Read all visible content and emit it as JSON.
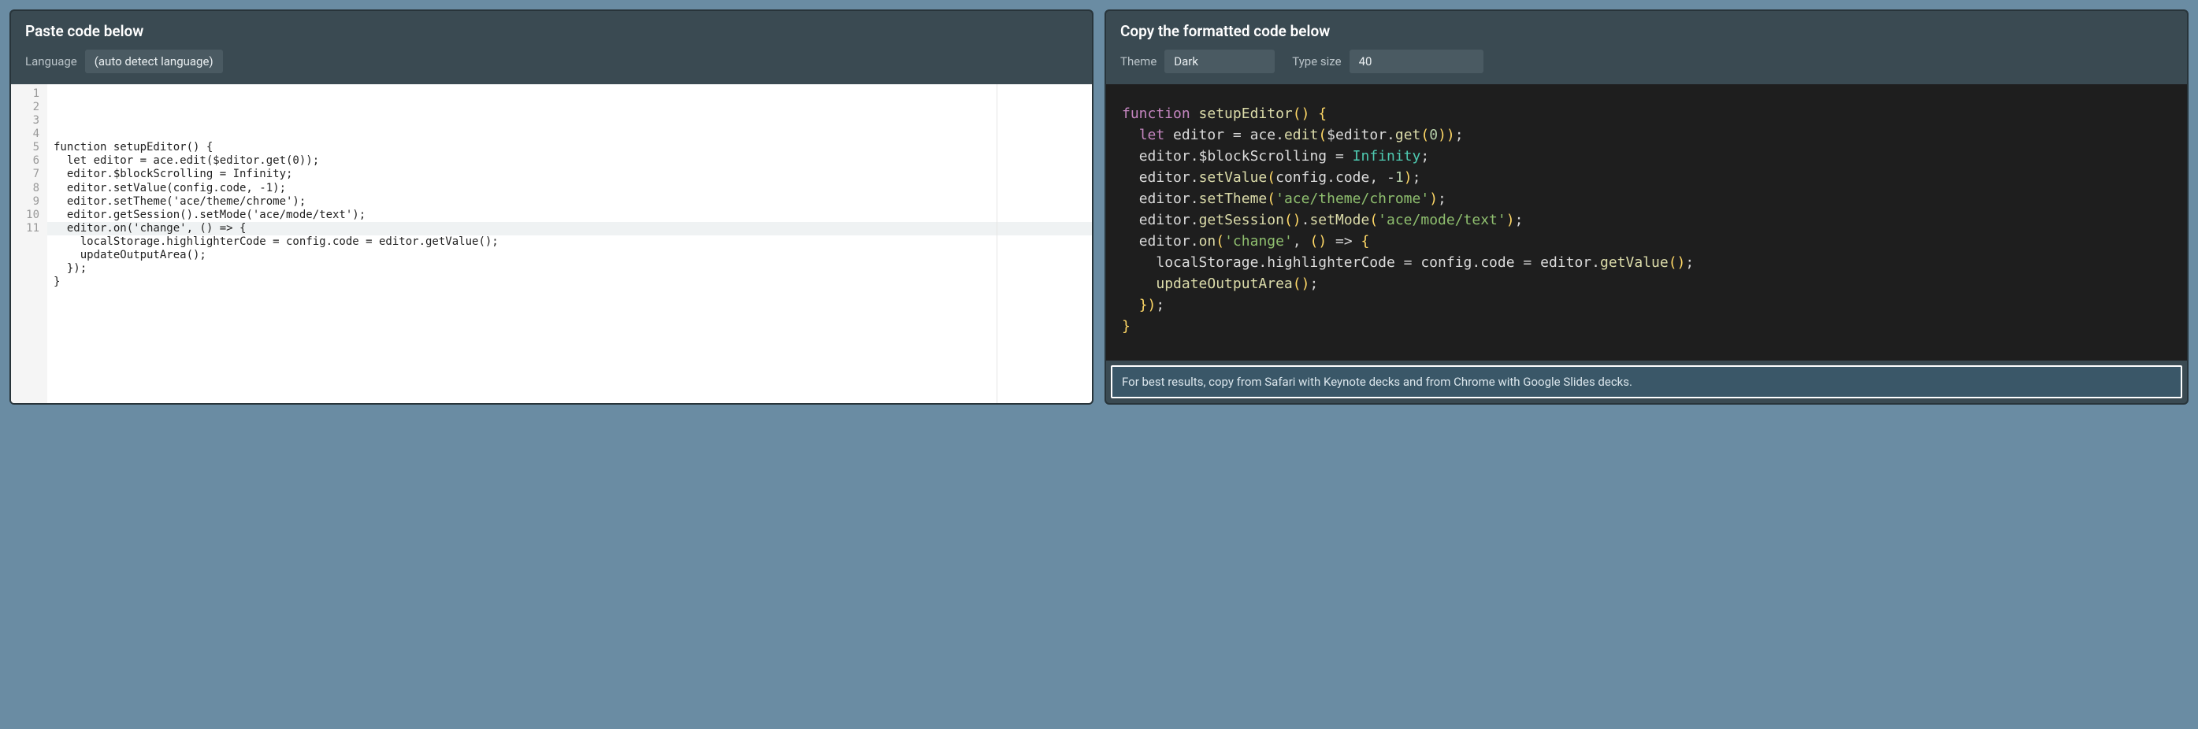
{
  "left": {
    "title": "Paste code below",
    "language_label": "Language",
    "language_value": "(auto detect language)",
    "line_numbers": [
      "1",
      "2",
      "3",
      "4",
      "5",
      "6",
      "7",
      "8",
      "9",
      "10",
      "11"
    ],
    "code_lines": [
      "function setupEditor() {",
      "  let editor = ace.edit($editor.get(0));",
      "  editor.$blockScrolling = Infinity;",
      "  editor.setValue(config.code, -1);",
      "  editor.setTheme('ace/theme/chrome');",
      "  editor.getSession().setMode('ace/mode/text');",
      "  editor.on('change', () => {",
      "    localStorage.highlighterCode = config.code = editor.getValue();",
      "    updateOutputArea();",
      "  });",
      "}"
    ],
    "active_line_index": 10
  },
  "right": {
    "title": "Copy the formatted code below",
    "theme_label": "Theme",
    "theme_value": "Dark",
    "size_label": "Type size",
    "size_value": "40",
    "tokens": [
      [
        [
          "k",
          "function"
        ],
        [
          "w",
          " "
        ],
        [
          "fn",
          "setupEditor"
        ],
        [
          "p",
          "()"
        ],
        [
          "w",
          " "
        ],
        [
          "p",
          "{"
        ]
      ],
      [
        [
          "w",
          "  "
        ],
        [
          "k",
          "let"
        ],
        [
          "w",
          " "
        ],
        [
          "w",
          "editor"
        ],
        [
          "w",
          " "
        ],
        [
          "op",
          "="
        ],
        [
          "w",
          " "
        ],
        [
          "w",
          "ace"
        ],
        [
          "op",
          "."
        ],
        [
          "fn",
          "edit"
        ],
        [
          "p",
          "("
        ],
        [
          "w",
          "$editor"
        ],
        [
          "op",
          "."
        ],
        [
          "fn",
          "get"
        ],
        [
          "p",
          "("
        ],
        [
          "num",
          "0"
        ],
        [
          "p",
          "))"
        ],
        [
          "op",
          ";"
        ]
      ],
      [
        [
          "w",
          "  "
        ],
        [
          "w",
          "editor"
        ],
        [
          "op",
          "."
        ],
        [
          "w",
          "$blockScrolling"
        ],
        [
          "w",
          " "
        ],
        [
          "op",
          "="
        ],
        [
          "w",
          " "
        ],
        [
          "c-id",
          "Infinity"
        ],
        [
          "op",
          ";"
        ]
      ],
      [
        [
          "w",
          "  "
        ],
        [
          "w",
          "editor"
        ],
        [
          "op",
          "."
        ],
        [
          "fn",
          "setValue"
        ],
        [
          "p",
          "("
        ],
        [
          "w",
          "config"
        ],
        [
          "op",
          "."
        ],
        [
          "w",
          "code"
        ],
        [
          "op",
          ","
        ],
        [
          "w",
          " "
        ],
        [
          "op",
          "-"
        ],
        [
          "num",
          "1"
        ],
        [
          "p",
          ")"
        ],
        [
          "op",
          ";"
        ]
      ],
      [
        [
          "w",
          "  "
        ],
        [
          "w",
          "editor"
        ],
        [
          "op",
          "."
        ],
        [
          "fn",
          "setTheme"
        ],
        [
          "p",
          "("
        ],
        [
          "str2",
          "'ace/theme/chrome'"
        ],
        [
          "p",
          ")"
        ],
        [
          "op",
          ";"
        ]
      ],
      [
        [
          "w",
          "  "
        ],
        [
          "w",
          "editor"
        ],
        [
          "op",
          "."
        ],
        [
          "fn",
          "getSession"
        ],
        [
          "p",
          "()"
        ],
        [
          "op",
          "."
        ],
        [
          "fn",
          "setMode"
        ],
        [
          "p",
          "("
        ],
        [
          "str2",
          "'ace/mode/text'"
        ],
        [
          "p",
          ")"
        ],
        [
          "op",
          ";"
        ]
      ],
      [
        [
          "w",
          "  "
        ],
        [
          "w",
          "editor"
        ],
        [
          "op",
          "."
        ],
        [
          "fn",
          "on"
        ],
        [
          "p",
          "("
        ],
        [
          "str2",
          "'change'"
        ],
        [
          "op",
          ","
        ],
        [
          "w",
          " "
        ],
        [
          "p",
          "()"
        ],
        [
          "w",
          " "
        ],
        [
          "op",
          "=>"
        ],
        [
          "w",
          " "
        ],
        [
          "p",
          "{"
        ]
      ],
      [
        [
          "w",
          "    "
        ],
        [
          "w",
          "localStorage"
        ],
        [
          "op",
          "."
        ],
        [
          "w",
          "highlighterCode"
        ],
        [
          "w",
          " "
        ],
        [
          "op",
          "="
        ],
        [
          "w",
          " "
        ],
        [
          "w",
          "config"
        ],
        [
          "op",
          "."
        ],
        [
          "w",
          "code"
        ],
        [
          "w",
          " "
        ],
        [
          "op",
          "="
        ],
        [
          "w",
          " "
        ],
        [
          "w",
          "editor"
        ],
        [
          "op",
          "."
        ],
        [
          "fn",
          "getValue"
        ],
        [
          "p",
          "()"
        ],
        [
          "op",
          ";"
        ]
      ],
      [
        [
          "w",
          "    "
        ],
        [
          "fn",
          "updateOutputArea"
        ],
        [
          "p",
          "()"
        ],
        [
          "op",
          ";"
        ]
      ],
      [
        [
          "w",
          "  "
        ],
        [
          "p",
          "})"
        ],
        [
          "op",
          ";"
        ]
      ],
      [
        [
          "p",
          "}"
        ]
      ]
    ],
    "tip": "For best results, copy from Safari with Keynote decks and from Chrome with Google Slides decks."
  }
}
